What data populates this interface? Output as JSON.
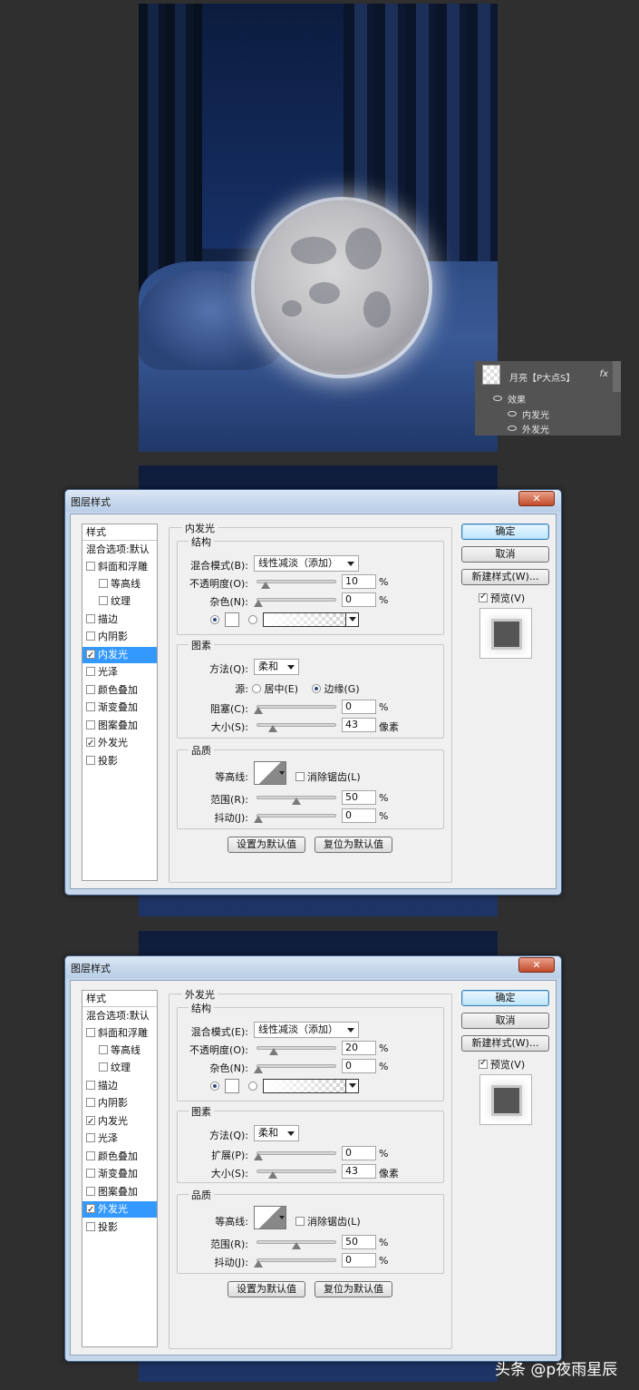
{
  "layers": {
    "layer_name": "月亮【P大点S】",
    "fx": "fx",
    "effects_label": "效果",
    "effect_1": "内发光",
    "effect_2": "外发光"
  },
  "dialogs": [
    {
      "title": "图层样式",
      "close": "✕",
      "styles_header": "样式",
      "blend_default": "混合选项:默认",
      "items": [
        "斜面和浮雕",
        "等高线",
        "纹理",
        "描边",
        "内阴影",
        "内发光",
        "光泽",
        "颜色叠加",
        "渐变叠加",
        "图案叠加",
        "外发光",
        "投影"
      ],
      "section_title": "内发光",
      "structure": "结构",
      "blend_mode_label": "混合模式(B):",
      "blend_mode_value": "线性减淡（添加）",
      "opacity_label": "不透明度(O):",
      "opacity_value": "10",
      "noise_label": "杂色(N):",
      "noise_value": "0",
      "percent": "%",
      "elements": "图素",
      "technique_label": "方法(Q):",
      "technique_value": "柔和",
      "source_label": "源:",
      "source_center": "居中(E)",
      "source_edge": "边缘(G)",
      "choke_label": "阻塞(C):",
      "choke_value": "0",
      "size_label": "大小(S):",
      "size_value": "43",
      "px": "像素",
      "quality": "品质",
      "contour_label": "等高线:",
      "antialias": "消除锯齿(L)",
      "range_label": "范围(R):",
      "range_value": "50",
      "jitter_label": "抖动(J):",
      "jitter_value": "0",
      "set_default": "设置为默认值",
      "reset_default": "复位为默认值",
      "ok": "确定",
      "cancel": "取消",
      "new_style": "新建样式(W)...",
      "preview": "预览(V)"
    },
    {
      "title": "图层样式",
      "close": "✕",
      "styles_header": "样式",
      "blend_default": "混合选项:默认",
      "items": [
        "斜面和浮雕",
        "等高线",
        "纹理",
        "描边",
        "内阴影",
        "内发光",
        "光泽",
        "颜色叠加",
        "渐变叠加",
        "图案叠加",
        "外发光",
        "投影"
      ],
      "section_title": "外发光",
      "structure": "结构",
      "blend_mode_label": "混合模式(E):",
      "blend_mode_value": "线性减淡（添加）",
      "opacity_label": "不透明度(O):",
      "opacity_value": "20",
      "noise_label": "杂色(N):",
      "noise_value": "0",
      "percent": "%",
      "elements": "图素",
      "technique_label": "方法(Q):",
      "technique_value": "柔和",
      "spread_label": "扩展(P):",
      "spread_value": "0",
      "size_label": "大小(S):",
      "size_value": "43",
      "px": "像素",
      "quality": "品质",
      "contour_label": "等高线:",
      "antialias": "消除锯齿(L)",
      "range_label": "范围(R):",
      "range_value": "50",
      "jitter_label": "抖动(J):",
      "jitter_value": "0",
      "set_default": "设置为默认值",
      "reset_default": "复位为默认值",
      "ok": "确定",
      "cancel": "取消",
      "new_style": "新建样式(W)...",
      "preview": "预览(V)"
    }
  ],
  "watermark": "头条 @p夜雨星辰"
}
